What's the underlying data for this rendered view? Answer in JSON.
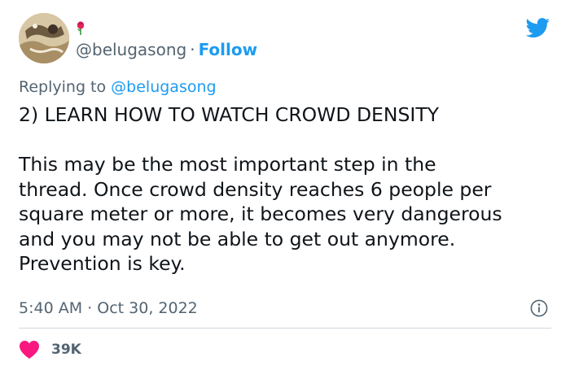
{
  "tweet": {
    "author": {
      "handle": "@belugasong",
      "follow_label": "Follow",
      "avatar_icon": "avatar-image",
      "emoji_icon": "rose-icon"
    },
    "separator": "·",
    "platform_icon": "twitter-bird-icon",
    "reply": {
      "prefix": "Replying to",
      "handle": "@belugasong"
    },
    "text": {
      "heading": "2) LEARN HOW TO WATCH CROWD DENSITY",
      "body": "This may be the most important step in the\nthread. Once crowd density reaches 6 people per\nsquare meter or more, it becomes very dangerous\nand you may not be able to get out anymore.\nPrevention is key."
    },
    "meta": {
      "time": "5:40 AM",
      "date": "Oct 30, 2022",
      "info_icon": "info-icon"
    },
    "likes": {
      "count": "39K",
      "icon": "heart-icon"
    },
    "colors": {
      "link": "#1d9bf0",
      "muted": "#536471",
      "text": "#0f1419",
      "heart": "#f91880",
      "divider": "#cfd9de"
    }
  }
}
